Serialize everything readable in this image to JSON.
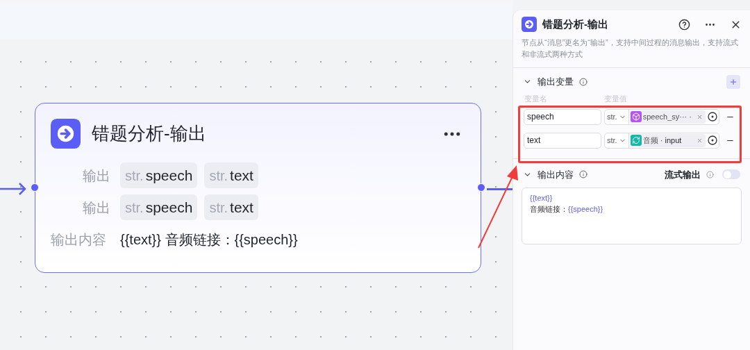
{
  "node": {
    "title": "错题分析-输出",
    "rows": [
      {
        "label": "输出",
        "tags": [
          {
            "type": "str.",
            "name": "speech"
          },
          {
            "type": "str.",
            "name": "text"
          }
        ]
      },
      {
        "label": "输出",
        "tags": [
          {
            "type": "str.",
            "name": "speech"
          },
          {
            "type": "str.",
            "name": "text"
          }
        ]
      }
    ],
    "content_label": "输出内容",
    "content": "{{text}} 音频链接：{{speech}}"
  },
  "panel": {
    "title": "错题分析-输出",
    "description": "节点从“消息”更名为“输出”，支持中间过程的消息输出，支持流式和非流式两种方式",
    "variables": {
      "title": "输出变量",
      "expanded": true,
      "columns": [
        "变量名",
        "变量值"
      ],
      "rows": [
        {
          "name": "speech",
          "type": "str.",
          "kind": "cube",
          "source": "speech_sy··· ·"
        },
        {
          "name": "text",
          "type": "str.",
          "kind": "loop",
          "source": "音频 · ",
          "source_field": "input"
        }
      ]
    },
    "content": {
      "title": "输出内容",
      "expanded": true,
      "stream_label": "流式输出",
      "stream_on": false,
      "lines": [
        [
          {
            "text": "{{text}}",
            "var": true
          }
        ],
        [
          {
            "text": "音频链接：",
            "var": false
          },
          {
            "text": "{{speech}}",
            "var": true
          }
        ]
      ]
    }
  }
}
